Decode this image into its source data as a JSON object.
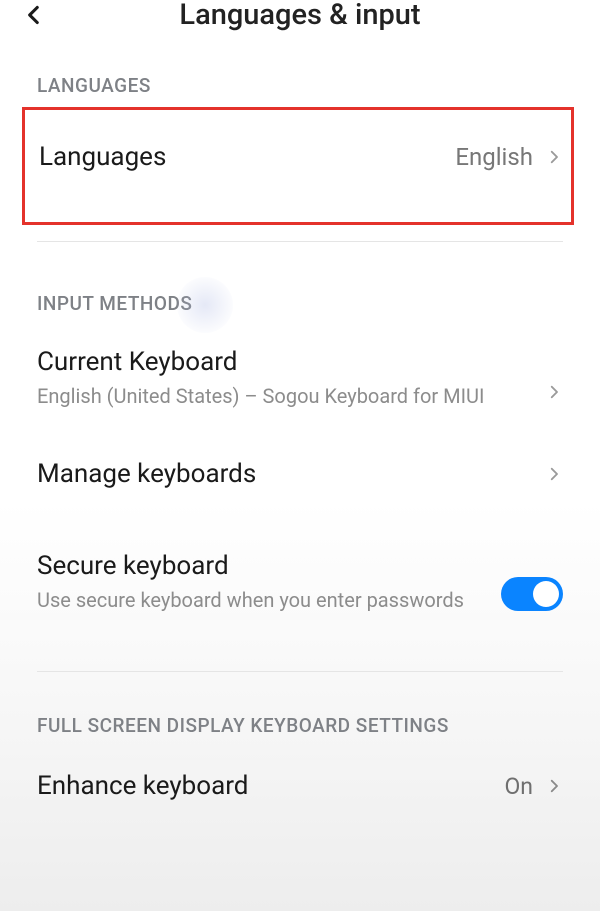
{
  "header": {
    "title": "Languages & input"
  },
  "sections": {
    "languages": {
      "header": "LANGUAGES",
      "row": {
        "label": "Languages",
        "value": "English"
      }
    },
    "input_methods": {
      "header": "INPUT METHODS",
      "current_keyboard": {
        "label": "Current Keyboard",
        "sub": "English (United States) – Sogou Keyboard for MIUI"
      },
      "manage": {
        "label": "Manage keyboards"
      },
      "secure": {
        "label": "Secure keyboard",
        "sub": "Use secure keyboard when you enter passwords",
        "state": "on"
      }
    },
    "fullscreen": {
      "header": "FULL SCREEN DISPLAY KEYBOARD SETTINGS",
      "enhance": {
        "label": "Enhance keyboard",
        "value": "On"
      }
    }
  }
}
